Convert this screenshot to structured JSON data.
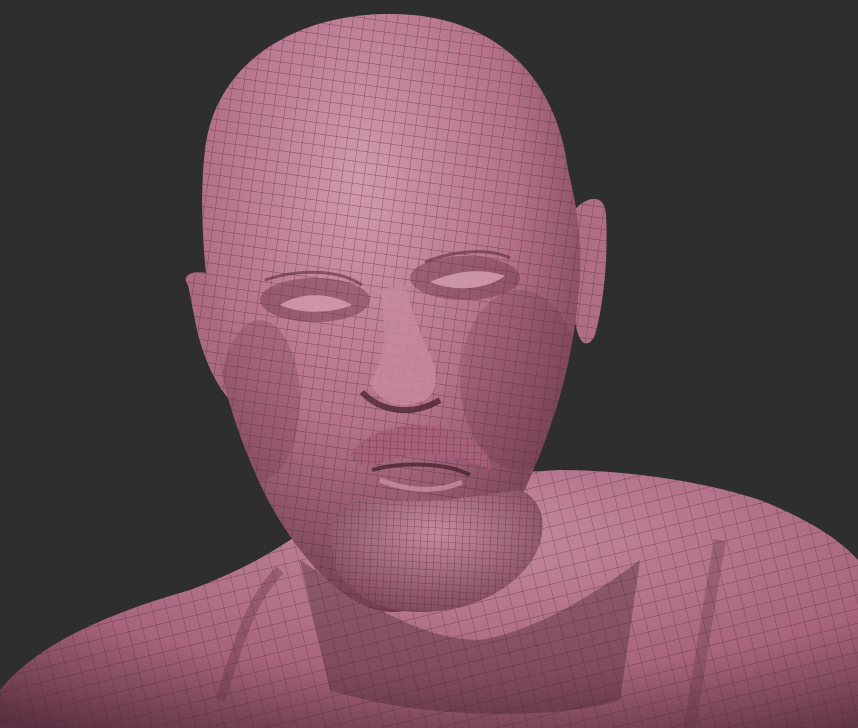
{
  "scene": {
    "subject": "wireframe-head-sculpt",
    "display_mode": "polyframe",
    "colors": {
      "background": "#2e2e2e",
      "material": "#b7778f",
      "material_light": "#cf93aa",
      "material_shadow": "#5a3040",
      "wire": "#3a2029"
    },
    "wire_opacity": 0.55
  }
}
